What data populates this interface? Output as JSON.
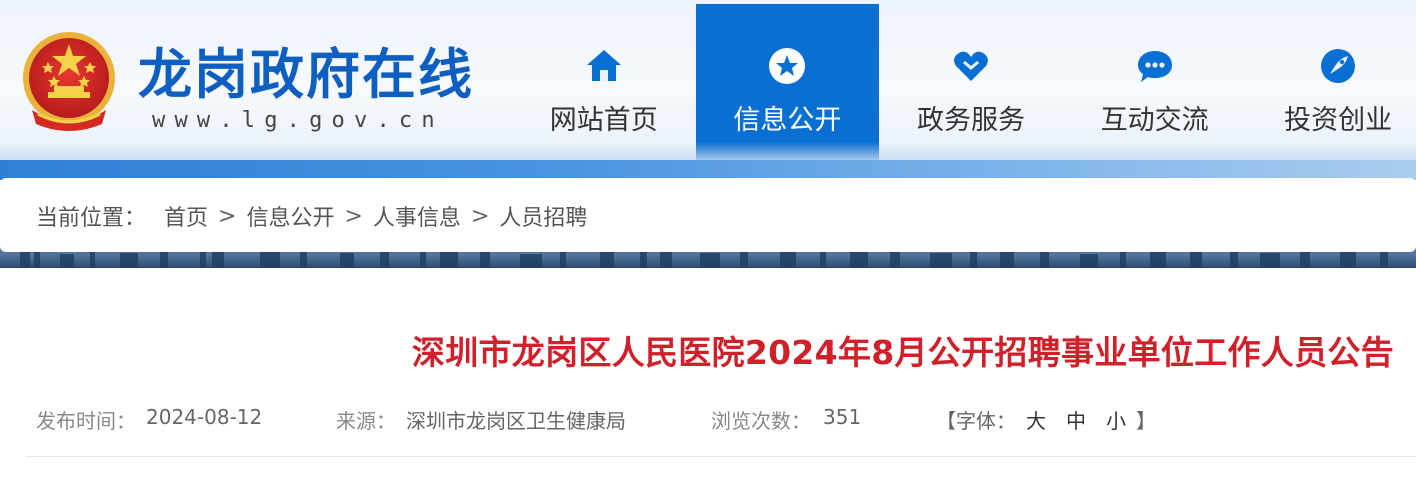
{
  "site": {
    "title": "龙岗政府在线",
    "url": "www.lg.gov.cn",
    "brand_color": "#0f5fc0"
  },
  "nav": {
    "items": [
      {
        "label": "网站首页",
        "icon": "home-icon",
        "active": false
      },
      {
        "label": "信息公开",
        "icon": "star-circle-icon",
        "active": true
      },
      {
        "label": "政务服务",
        "icon": "heart-icon",
        "active": false
      },
      {
        "label": "互动交流",
        "icon": "chat-bubble-icon",
        "active": false
      },
      {
        "label": "投资创业",
        "icon": "rocket-icon",
        "active": false
      }
    ],
    "active_color": "#0a6fd3"
  },
  "breadcrumb": {
    "lead": "当前位置：",
    "separator": ">",
    "items": [
      "首页",
      "信息公开",
      "人事信息",
      "人员招聘"
    ]
  },
  "article": {
    "title": "深圳市龙岗区人民医院2024年8月公开招聘事业单位工作人员公告",
    "title_color": "#d0202a",
    "publish_label": "发布时间：",
    "publish_date": "2024-08-12",
    "source_label": "来源：",
    "source": "深圳市龙岗区卫生健康局",
    "views_label": "浏览次数：",
    "views": "351",
    "font_label": "【字体：",
    "font_large": "大",
    "font_medium": "中",
    "font_small": "小",
    "font_close": "】"
  }
}
